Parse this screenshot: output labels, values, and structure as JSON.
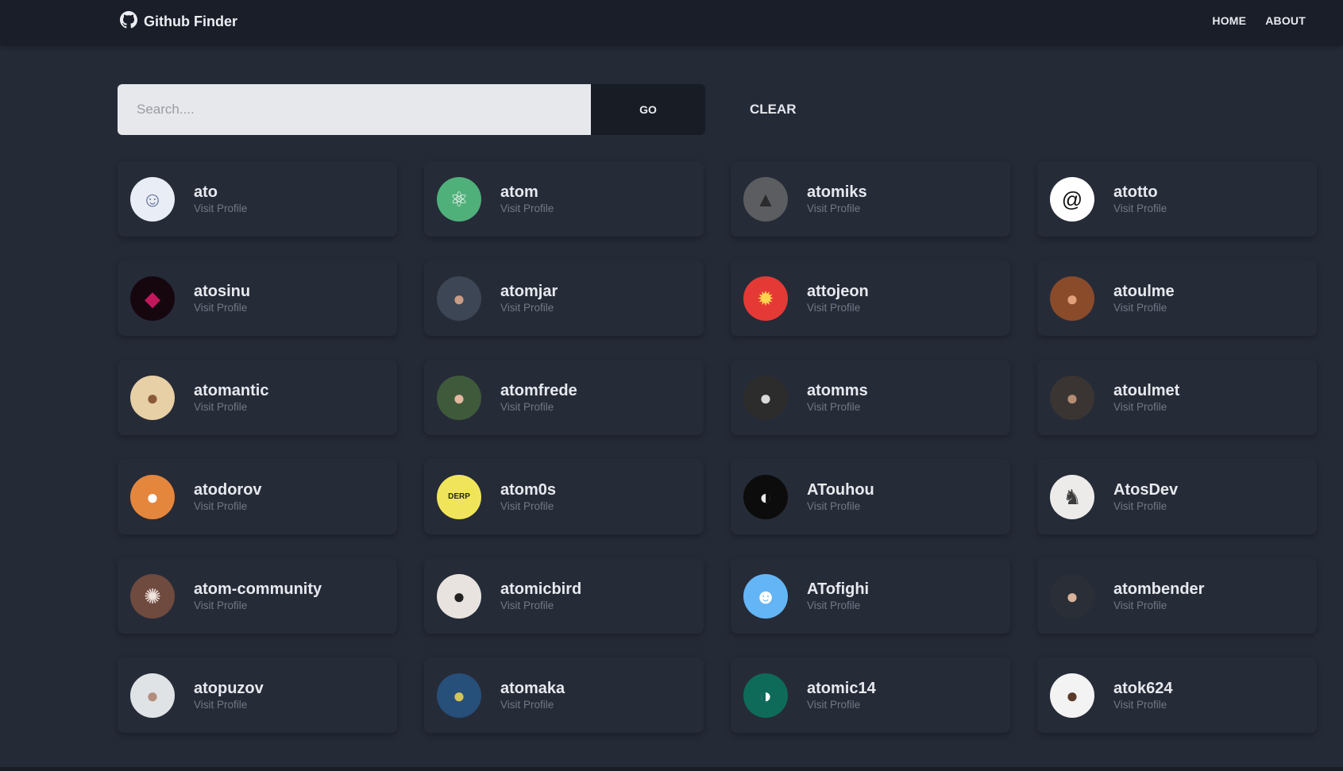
{
  "nav": {
    "brand": "Github Finder",
    "links": [
      "HOME",
      "ABOUT"
    ]
  },
  "search": {
    "placeholder": "Search....",
    "value": "",
    "go_label": "GO",
    "clear_label": "CLEAR"
  },
  "visit_label": "Visit Profile",
  "users": [
    {
      "login": "ato",
      "avatar": {
        "bg": "#e9edf5",
        "fg": "#5a6a9a",
        "glyph": "☺"
      }
    },
    {
      "login": "atom",
      "avatar": {
        "bg": "#4fb07a",
        "fg": "#ffffff",
        "glyph": "⚛"
      }
    },
    {
      "login": "atomiks",
      "avatar": {
        "bg": "#5b5d60",
        "fg": "#2b2b2b",
        "glyph": "▲"
      }
    },
    {
      "login": "atotto",
      "avatar": {
        "bg": "#ffffff",
        "fg": "#111111",
        "glyph": "@"
      }
    },
    {
      "login": "atosinu",
      "avatar": {
        "bg": "#16070f",
        "fg": "#c2185b",
        "glyph": "◆"
      }
    },
    {
      "login": "atomjar",
      "avatar": {
        "bg": "#3d4654",
        "fg": "#c99c86",
        "glyph": "●"
      }
    },
    {
      "login": "attojeon",
      "avatar": {
        "bg": "#e53935",
        "fg": "#ffd54f",
        "glyph": "✹"
      }
    },
    {
      "login": "atoulme",
      "avatar": {
        "bg": "#8a4b2a",
        "fg": "#e2a17a",
        "glyph": "●"
      }
    },
    {
      "login": "atomantic",
      "avatar": {
        "bg": "#e7cfa6",
        "fg": "#8a5a36",
        "glyph": "●"
      }
    },
    {
      "login": "atomfrede",
      "avatar": {
        "bg": "#3f5a3b",
        "fg": "#e1b8a0",
        "glyph": "●"
      }
    },
    {
      "login": "atomms",
      "avatar": {
        "bg": "#2c2c2c",
        "fg": "#d9d9d9",
        "glyph": "●"
      }
    },
    {
      "login": "atoulmet",
      "avatar": {
        "bg": "#3a3533",
        "fg": "#b58c74",
        "glyph": "●"
      }
    },
    {
      "login": "atodorov",
      "avatar": {
        "bg": "#e5863d",
        "fg": "#ffffff",
        "glyph": "●"
      }
    },
    {
      "login": "atom0s",
      "avatar": {
        "bg": "#f0e55a",
        "fg": "#222222",
        "glyph": "DERP"
      }
    },
    {
      "login": "ATouhou",
      "avatar": {
        "bg": "#0c0c0c",
        "fg": "#eaeaea",
        "glyph": "◐"
      }
    },
    {
      "login": "AtosDev",
      "avatar": {
        "bg": "#ecebea",
        "fg": "#3b3b3b",
        "glyph": "♞"
      }
    },
    {
      "login": "atom-community",
      "avatar": {
        "bg": "#6e4a3f",
        "fg": "#f1e4df",
        "glyph": "✺"
      }
    },
    {
      "login": "atomicbird",
      "avatar": {
        "bg": "#e8e3df",
        "fg": "#222222",
        "glyph": "●"
      }
    },
    {
      "login": "ATofighi",
      "avatar": {
        "bg": "#64b5f6",
        "fg": "#ffffff",
        "glyph": "☻"
      }
    },
    {
      "login": "atombender",
      "avatar": {
        "bg": "#2a2e36",
        "fg": "#d8b29a",
        "glyph": "●"
      }
    },
    {
      "login": "atopuzov",
      "avatar": {
        "bg": "#dfe3e6",
        "fg": "#b38c7c",
        "glyph": "●"
      }
    },
    {
      "login": "atomaka",
      "avatar": {
        "bg": "#264f7a",
        "fg": "#d3c45a",
        "glyph": "●"
      }
    },
    {
      "login": "atomic14",
      "avatar": {
        "bg": "#0e6b5a",
        "fg": "#ffffff",
        "glyph": "◑"
      }
    },
    {
      "login": "atok624",
      "avatar": {
        "bg": "#f3f3f3",
        "fg": "#5a3b2a",
        "glyph": "●"
      }
    }
  ]
}
